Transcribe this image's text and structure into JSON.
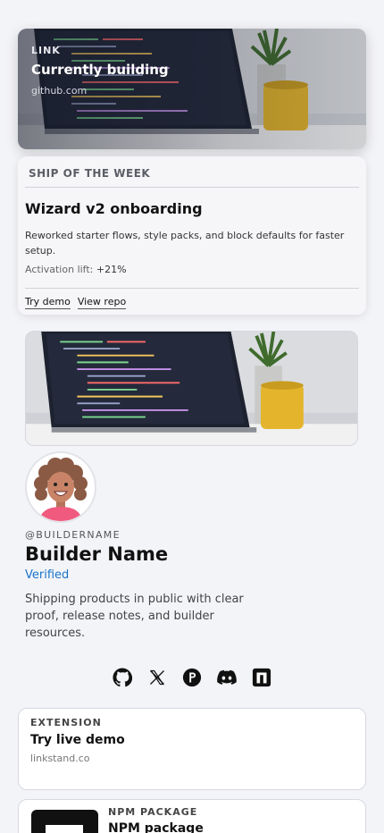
{
  "link_card": {
    "kicker": "LINK",
    "title": "Currently building",
    "domain": "github.com"
  },
  "ship": {
    "kicker": "SHIP OF THE WEEK",
    "title": "Wizard v2 onboarding",
    "description": "Reworked starter flows, style packs, and block defaults for faster setup.",
    "metric_label": "Activation lift:",
    "metric_value": "+21%",
    "try_demo": "Try demo",
    "view_repo": "View repo"
  },
  "profile": {
    "handle": "@BUILDERNAME",
    "name": "Builder Name",
    "verified": "Verified",
    "bio": "Shipping products in public with clear proof, release notes, and builder resources."
  },
  "socials": [
    {
      "icon": "github-icon"
    },
    {
      "icon": "x-icon"
    },
    {
      "icon": "producthunt-icon"
    },
    {
      "icon": "discord-icon"
    },
    {
      "icon": "substack-icon"
    }
  ],
  "extension_card": {
    "kicker": "EXTENSION",
    "title": "Try live demo",
    "domain": "linkstand.co"
  },
  "npm_card": {
    "kicker": "NPM PACKAGE",
    "title": "NPM package"
  },
  "colors": {
    "background": "#f3f4f8",
    "verified": "#1a73c9",
    "avatar_shirt": "#f05a7e"
  }
}
